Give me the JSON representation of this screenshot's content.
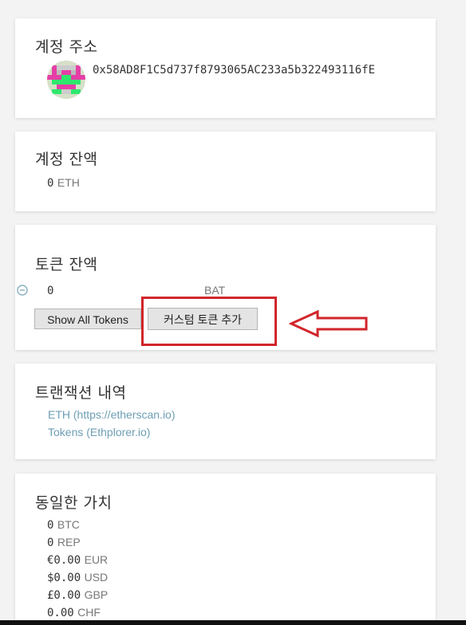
{
  "account_address": {
    "title": "계정 주소",
    "address": "0x58AD8F1C5d737f8793065AC233a5b322493116fE",
    "avatar_icon": "identicon-avatar"
  },
  "account_balance": {
    "title": "계정 잔액",
    "amount": "0",
    "unit": "ETH"
  },
  "token_balance": {
    "title": "토큰 잔액",
    "tokens": [
      {
        "amount": "0",
        "symbol": "BAT"
      }
    ],
    "show_all_label": "Show All Tokens",
    "add_custom_label": "커스텀 토큰 추가",
    "annotation_color": "#d2252b"
  },
  "transaction_history": {
    "title": "트랜잭션 내역",
    "links": [
      "ETH (https://etherscan.io)",
      "Tokens (Ethplorer.io)"
    ],
    "link_color": "#6d9eb4"
  },
  "equivalent_values": {
    "title": "동일한 가치",
    "values": [
      {
        "amount": "0",
        "unit": "BTC"
      },
      {
        "amount": "0",
        "unit": "REP"
      },
      {
        "amount": "€0.00",
        "unit": "EUR"
      },
      {
        "amount": "$0.00",
        "unit": "USD"
      },
      {
        "amount": "£0.00",
        "unit": "GBP"
      },
      {
        "amount": "0.00",
        "unit": "CHF"
      }
    ]
  }
}
